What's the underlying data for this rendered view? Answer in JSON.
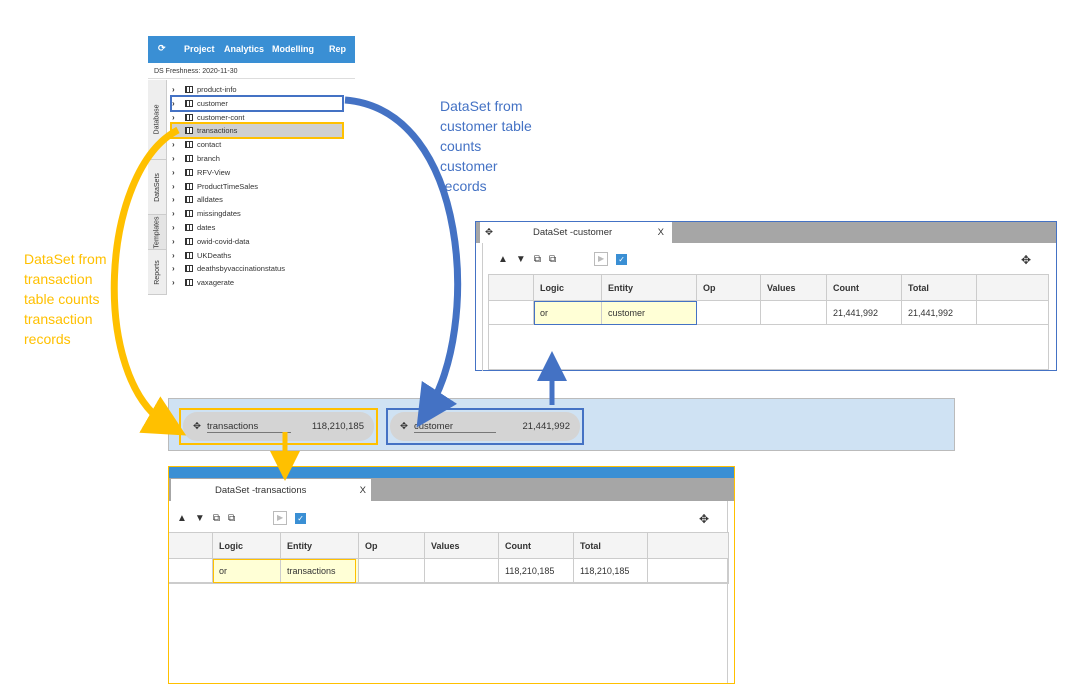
{
  "app": {
    "menu": [
      "Project",
      "Analytics",
      "Modelling",
      "Rep"
    ],
    "refresh_icon": "refresh-icon",
    "freshness": "DS  Freshness: 2020-11-30",
    "side_tabs": [
      "Database",
      "DataSets",
      "Templates",
      "Reports"
    ],
    "tables": [
      "product-info",
      "customer",
      "customer-cont",
      "transactions",
      "contact",
      "branch",
      "RFV-View",
      "ProductTimeSales",
      "alldates",
      "missingdates",
      "dates",
      "owid-covid-data",
      "UKDeaths",
      "deathsbyvaccinationstatus",
      "vaxagerate"
    ]
  },
  "annotations": {
    "customer": [
      "DataSet from",
      "customer table",
      "counts",
      "customer",
      "records"
    ],
    "transactions": [
      "DataSet from",
      "transaction",
      "table counts",
      "transaction",
      "records"
    ]
  },
  "colors": {
    "customer": "#4472c4",
    "transactions": "#ffc000",
    "app_blue": "#3a8fd4"
  },
  "customer_panel": {
    "tab": "DataSet -customer",
    "close": "X",
    "columns": [
      "",
      "Logic",
      "Entity",
      "Op",
      "Values",
      "Count",
      "Total",
      ""
    ],
    "row": [
      "",
      "or",
      "customer",
      "",
      "",
      "21,441,992",
      "21,441,992",
      ""
    ]
  },
  "transactions_panel": {
    "tab": "DataSet -transactions",
    "close": "X",
    "columns": [
      "",
      "Logic",
      "Entity",
      "Op",
      "Values",
      "Count",
      "Total",
      ""
    ],
    "row": [
      "",
      "or",
      "transactions",
      "",
      "",
      "118,210,185",
      "118,210,185",
      ""
    ]
  },
  "pills": [
    {
      "name": "transactions",
      "count": "118,210,185"
    },
    {
      "name": "customer",
      "count": "21,441,992"
    }
  ]
}
